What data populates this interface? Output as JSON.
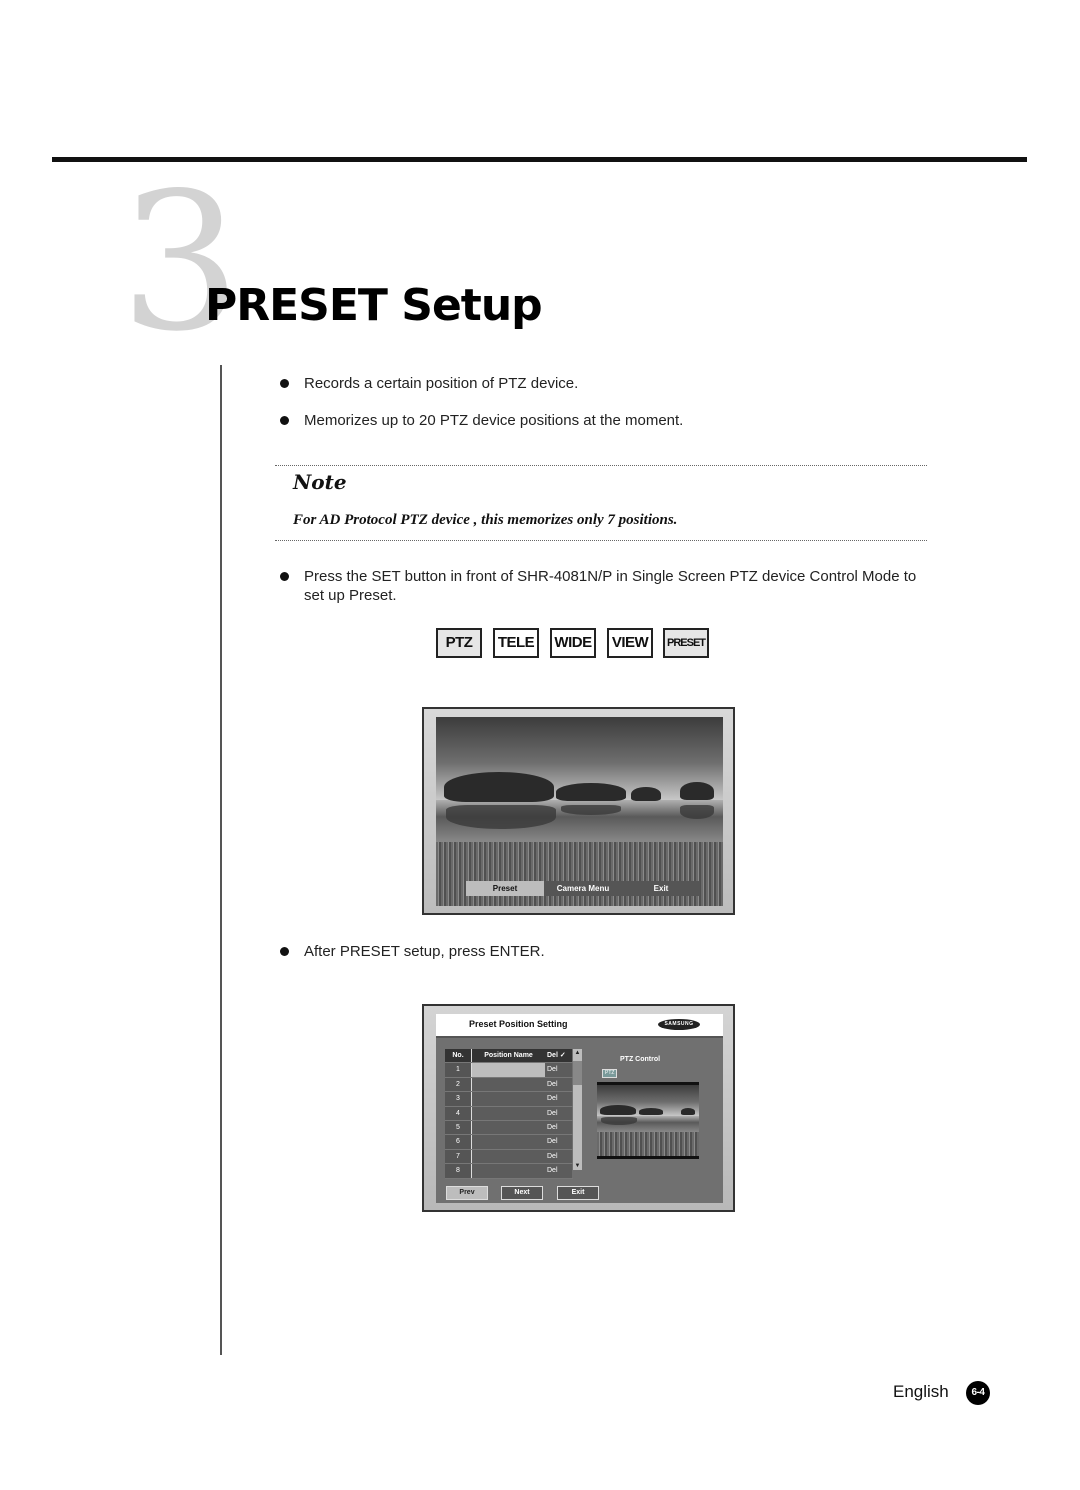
{
  "header": {
    "section_number": "3",
    "title": "PRESET Setup"
  },
  "bullets_intro": [
    "Records a certain position of PTZ device.",
    "Memorizes up to 20 PTZ device positions at the moment."
  ],
  "note": {
    "title": "Note",
    "text": "For AD Protocol PTZ device , this memorizes only 7 positions."
  },
  "bullet_press_set": "Press the SET button in front of SHR-4081N/P in Single Screen PTZ device Control Mode to set up Preset.",
  "keys": [
    {
      "label": "PTZ",
      "highlighted": true
    },
    {
      "label": "TELE",
      "highlighted": false
    },
    {
      "label": "WIDE",
      "highlighted": false
    },
    {
      "label": "VIEW",
      "highlighted": false
    },
    {
      "label": "PRESET",
      "highlighted": true
    }
  ],
  "screen1": {
    "menu": [
      {
        "label": "Preset",
        "selected": true
      },
      {
        "label": "Camera Menu",
        "selected": false
      },
      {
        "label": "Exit",
        "selected": false
      }
    ]
  },
  "bullet_after": "After PRESET setup, press ENTER.",
  "screen2": {
    "title": "Preset Position Setting",
    "logo": "SAMSUNG",
    "table": {
      "headers": [
        "No.",
        "Position Name",
        "Del ✓"
      ],
      "rows": [
        {
          "no": "1",
          "name": "",
          "del": "Del"
        },
        {
          "no": "2",
          "name": "",
          "del": "Del"
        },
        {
          "no": "3",
          "name": "",
          "del": "Del"
        },
        {
          "no": "4",
          "name": "",
          "del": "Del"
        },
        {
          "no": "5",
          "name": "",
          "del": "Del"
        },
        {
          "no": "6",
          "name": "",
          "del": "Del"
        },
        {
          "no": "7",
          "name": "",
          "del": "Del"
        },
        {
          "no": "8",
          "name": "",
          "del": "Del"
        }
      ]
    },
    "ptz_control_label": "PTZ Control",
    "ptz_badge": "PTZ",
    "buttons": [
      {
        "label": "Prev",
        "selected": true
      },
      {
        "label": "Next",
        "selected": false
      },
      {
        "label": "Exit",
        "selected": false
      }
    ]
  },
  "footer": {
    "language": "English",
    "page": "6-4"
  }
}
